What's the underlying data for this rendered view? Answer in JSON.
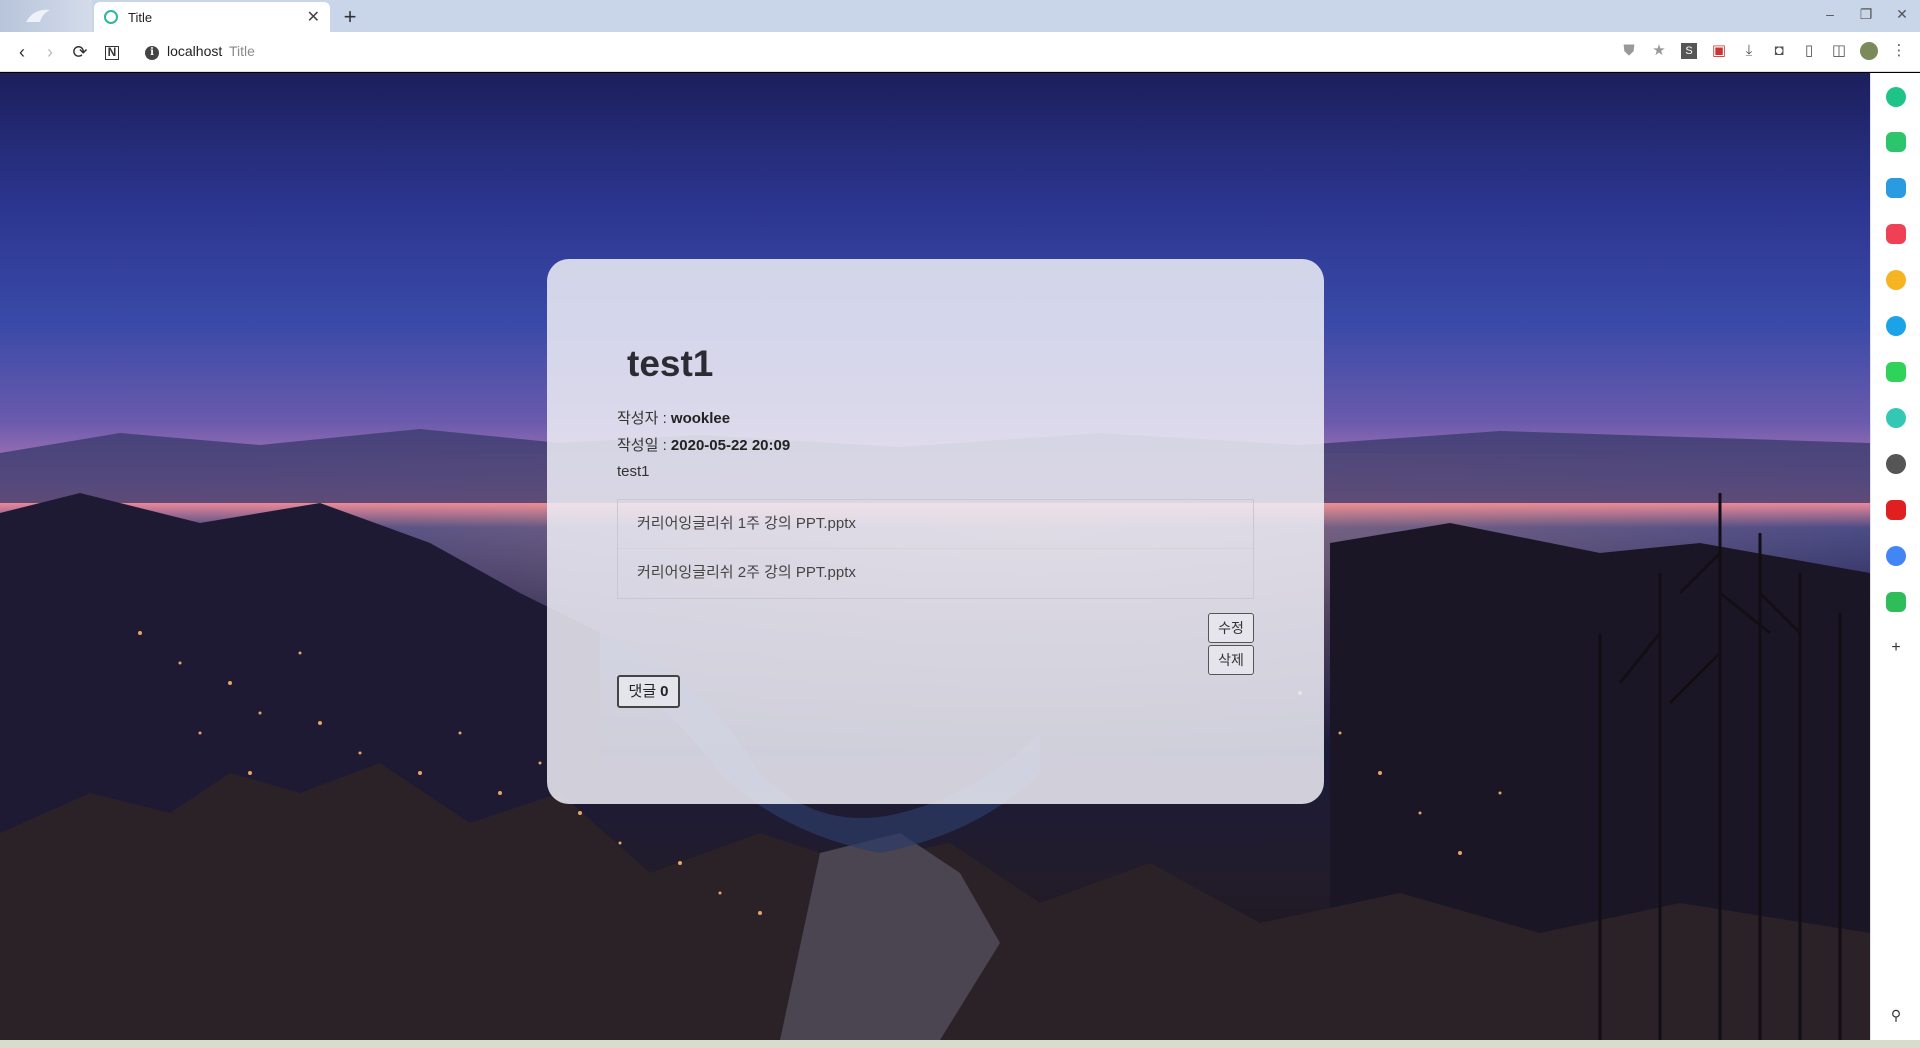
{
  "browser": {
    "tab_title": "Title",
    "url_host": "localhost",
    "url_title": "Title"
  },
  "post": {
    "title": "test1",
    "author_label": "작성자 :",
    "author": "wooklee",
    "date_label": "작성일 :",
    "date": "2020-05-22 20:09",
    "content": "test1",
    "files": [
      "커리어잉글리쉬 1주 강의 PPT.pptx",
      "커리어잉글리쉬 2주 강의 PPT.pptx"
    ],
    "edit_label": "수정",
    "delete_label": "삭제",
    "comments_label": "댓글",
    "comments_count": "0"
  },
  "colors": {
    "accent": "#2fb5a4",
    "card_bg": "#eeeef6"
  }
}
